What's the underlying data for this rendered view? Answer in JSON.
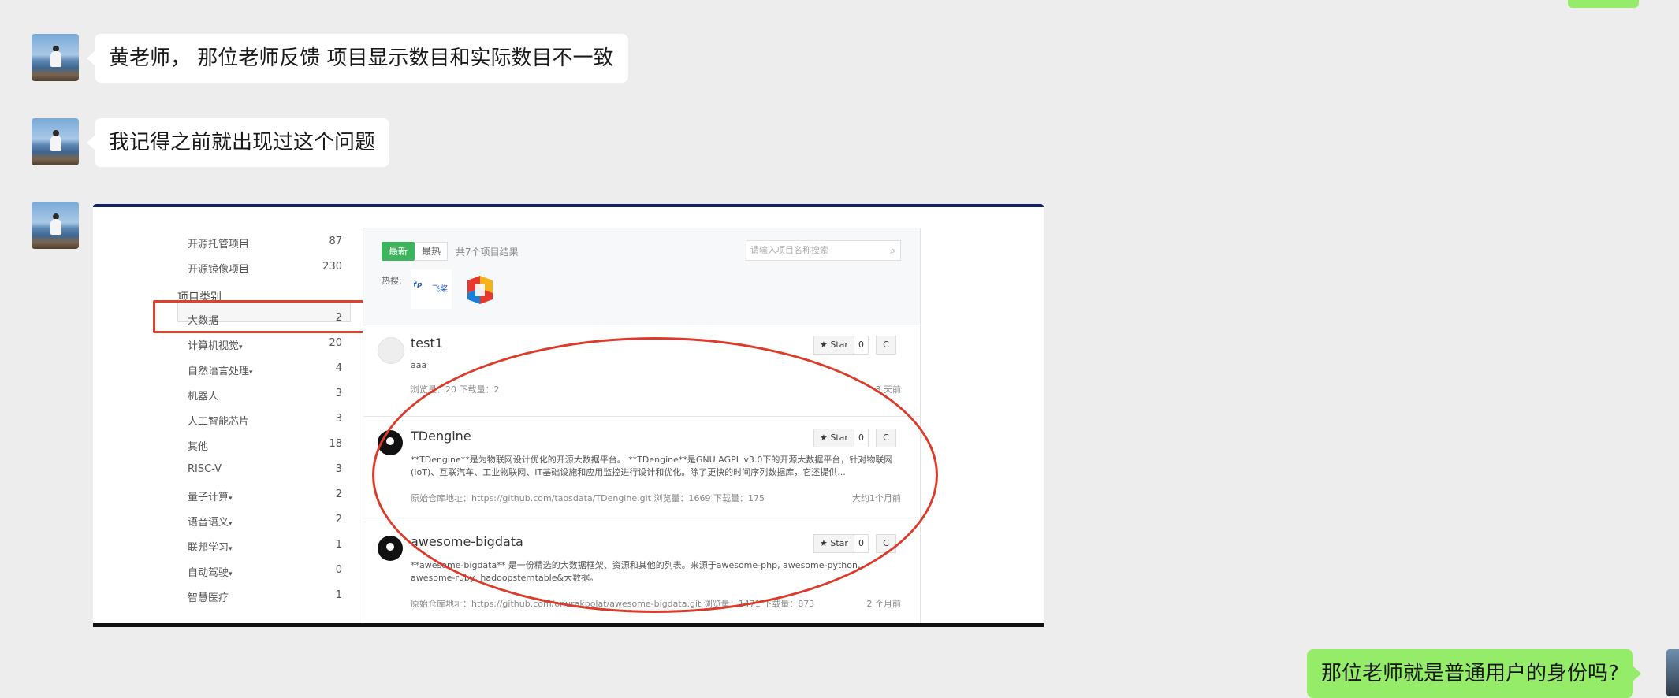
{
  "messages": [
    {
      "from": "other",
      "text": "黄老师， 那位老师反馈 项目显示数目和实际数目不一致"
    },
    {
      "from": "other",
      "text": "我记得之前就出现过这个问题"
    },
    {
      "from": "me",
      "text": "那位老师就是普通用户的身份吗?"
    }
  ],
  "screenshot": {
    "left_list": [
      {
        "label": "开源托管项目",
        "count": "87"
      },
      {
        "label": "开源镜像项目",
        "count": "230"
      }
    ],
    "category_heading": "项目类别",
    "categories": [
      {
        "label": "大数据",
        "count": "2"
      },
      {
        "label": "计算机视觉",
        "count": "20",
        "caret": "▾"
      },
      {
        "label": "自然语言处理",
        "count": "4",
        "caret": "▾"
      },
      {
        "label": "机器人",
        "count": "3"
      },
      {
        "label": "人工智能芯片",
        "count": "3"
      },
      {
        "label": "其他",
        "count": "18"
      },
      {
        "label": "RISC-V",
        "count": "3"
      },
      {
        "label": "量子计算",
        "count": "2",
        "caret": "▾"
      },
      {
        "label": "语音语义",
        "count": "2",
        "caret": "▾"
      },
      {
        "label": "联邦学习",
        "count": "1",
        "caret": "▾"
      },
      {
        "label": "自动驾驶",
        "count": "0",
        "caret": "▾"
      },
      {
        "label": "智慧医疗",
        "count": "1"
      }
    ],
    "sort": {
      "newest": "最新",
      "hottest": "最热"
    },
    "result_count": "共7个项目结果",
    "search_placeholder": "请输入项目名称搜索",
    "search_icon": "⌕",
    "hot_label": "热搜:",
    "hot_logos": {
      "logo1_mark": "ᶠᵖ",
      "logo1_text": "飞桨"
    },
    "star_label": "★ Star",
    "c_label": "C",
    "projects": [
      {
        "name": "test1",
        "desc": "aaa",
        "meta": "浏览量：20   下载量：2",
        "time": "3 天前",
        "stars": "0"
      },
      {
        "name": "TDengine",
        "desc": "**TDengine**是为物联网设计优化的开源大数据平台。 **TDengine**是GNU AGPL v3.0下的开源大数据平台，针对物联网(IoT)、互联汽车、工业物联网、IT基础设施和应用监控进行设计和优化。除了更快的时间序列数据库，它还提供...",
        "meta": "原始仓库地址：https://github.com/taosdata/TDengine.git     浏览量：1669   下载量：175",
        "time": "大约1个月前",
        "stars": "0"
      },
      {
        "name": "awesome-bigdata",
        "desc": "**awesome-bigdata** 是一份精选的大数据框架、资源和其他的列表。来源于awesome-php, awesome-python, awesome-ruby, hadoopsterntable&大数据。",
        "meta": "原始仓库地址：https://github.com/onurakpolat/awesome-bigdata.git     浏览量：1471   下载量：873",
        "time": "2 个月前",
        "stars": "0"
      }
    ]
  },
  "colors": {
    "chat_bg": "#ededed",
    "bubble_other": "#ffffff",
    "bubble_me": "#95ec69",
    "annotation_red": "#dc3b2b",
    "accent_green": "#3cb55c"
  }
}
